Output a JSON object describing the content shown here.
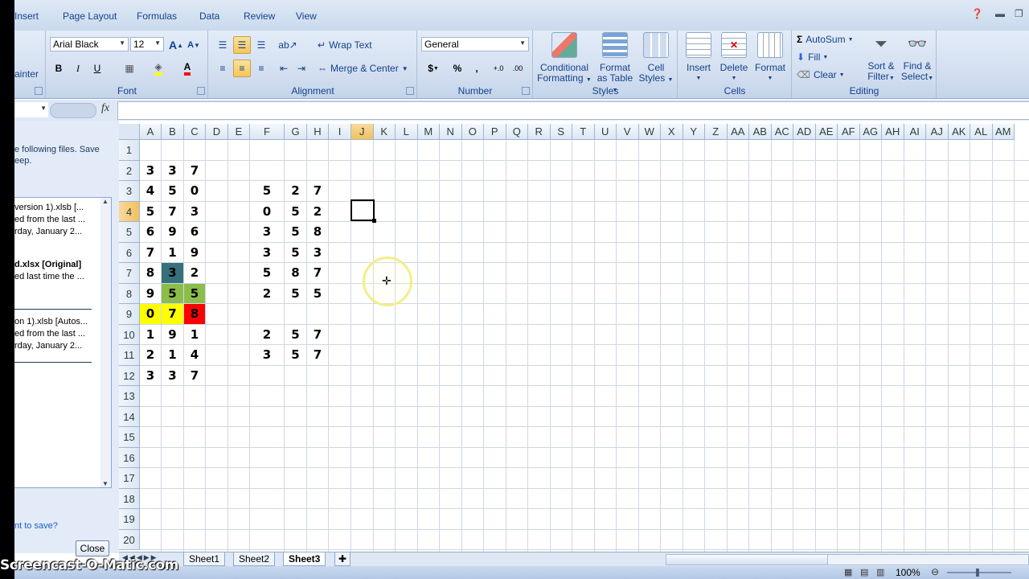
{
  "ribbon": {
    "tabs": [
      "Insert",
      "Page Layout",
      "Formulas",
      "Data",
      "Review",
      "View"
    ],
    "clipboard_partial": "ainter",
    "font": {
      "name": "Arial Black",
      "size": "12",
      "grow": "A",
      "shrink": "A",
      "bold": "B",
      "italic": "I",
      "underline": "U",
      "group_label": "Font"
    },
    "alignment": {
      "wrap_text": "Wrap Text",
      "merge_center": "Merge & Center",
      "group_label": "Alignment"
    },
    "number": {
      "format": "General",
      "currency": "$",
      "percent": "%",
      "comma": ",",
      "group_label": "Number"
    },
    "styles": {
      "conditional": [
        "Conditional",
        "Formatting"
      ],
      "format_table": [
        "Format",
        "as Table"
      ],
      "cell_styles": [
        "Cell",
        "Styles"
      ],
      "group_label": "Styles"
    },
    "cells": {
      "insert": "Insert",
      "delete": "Delete",
      "format": "Format",
      "group_label": "Cells"
    },
    "editing": {
      "autosum": "AutoSum",
      "fill": "Fill",
      "clear": "Clear",
      "sort": [
        "Sort &",
        "Filter"
      ],
      "find": [
        "Find &",
        "Select"
      ],
      "group_label": "Editing"
    }
  },
  "formula_bar": {
    "fx": "fx",
    "value": ""
  },
  "recovery_pane": {
    "intro": [
      "e following files.  Save",
      "eep."
    ],
    "files": [
      {
        "lines": [
          "version 1).xlsb  [...",
          "ed from the last ...",
          "rday, January 2..."
        ],
        "bold": false
      },
      {
        "lines": [
          "d.xlsx  [Original]",
          "ed last time the ..."
        ],
        "bold": true
      },
      {
        "lines": [
          "on 1).xlsb  [Autos...",
          "ed from the last ...",
          "rday, January 2..."
        ],
        "bold": false
      }
    ],
    "question": "nt to save?",
    "close": "Close"
  },
  "grid": {
    "columns": [
      "A",
      "B",
      "C",
      "D",
      "E",
      "F",
      "G",
      "H",
      "I",
      "J",
      "K",
      "L",
      "M",
      "N",
      "O",
      "P",
      "Q",
      "R",
      "S",
      "T",
      "U",
      "V",
      "W",
      "X",
      "Y",
      "Z",
      "AA",
      "AB",
      "AC",
      "AD",
      "AE",
      "AF",
      "AG",
      "AH",
      "AI",
      "AJ",
      "AK",
      "AL",
      "AM"
    ],
    "rows": [
      "1",
      "2",
      "3",
      "4",
      "5",
      "6",
      "7",
      "8",
      "9",
      "10",
      "11",
      "12",
      "13",
      "14",
      "15",
      "16",
      "17",
      "18",
      "19",
      "20"
    ],
    "active_column": "J",
    "active_row": "4",
    "cells": [
      {
        "c": "A",
        "r": 2,
        "v": "3"
      },
      {
        "c": "B",
        "r": 2,
        "v": "3"
      },
      {
        "c": "C",
        "r": 2,
        "v": "7"
      },
      {
        "c": "A",
        "r": 3,
        "v": "4"
      },
      {
        "c": "B",
        "r": 3,
        "v": "5"
      },
      {
        "c": "C",
        "r": 3,
        "v": "0"
      },
      {
        "c": "F",
        "r": 3,
        "v": "5"
      },
      {
        "c": "G",
        "r": 3,
        "v": "2"
      },
      {
        "c": "H",
        "r": 3,
        "v": "7"
      },
      {
        "c": "A",
        "r": 4,
        "v": "5"
      },
      {
        "c": "B",
        "r": 4,
        "v": "7"
      },
      {
        "c": "C",
        "r": 4,
        "v": "3"
      },
      {
        "c": "F",
        "r": 4,
        "v": "0"
      },
      {
        "c": "G",
        "r": 4,
        "v": "5"
      },
      {
        "c": "H",
        "r": 4,
        "v": "2"
      },
      {
        "c": "A",
        "r": 5,
        "v": "6"
      },
      {
        "c": "B",
        "r": 5,
        "v": "9"
      },
      {
        "c": "C",
        "r": 5,
        "v": "6"
      },
      {
        "c": "F",
        "r": 5,
        "v": "3"
      },
      {
        "c": "G",
        "r": 5,
        "v": "5"
      },
      {
        "c": "H",
        "r": 5,
        "v": "8"
      },
      {
        "c": "A",
        "r": 6,
        "v": "7"
      },
      {
        "c": "B",
        "r": 6,
        "v": "1"
      },
      {
        "c": "C",
        "r": 6,
        "v": "9"
      },
      {
        "c": "F",
        "r": 6,
        "v": "3"
      },
      {
        "c": "G",
        "r": 6,
        "v": "5"
      },
      {
        "c": "H",
        "r": 6,
        "v": "3"
      },
      {
        "c": "A",
        "r": 7,
        "v": "8"
      },
      {
        "c": "B",
        "r": 7,
        "v": "3",
        "bg": "#35707b"
      },
      {
        "c": "C",
        "r": 7,
        "v": "2"
      },
      {
        "c": "F",
        "r": 7,
        "v": "5"
      },
      {
        "c": "G",
        "r": 7,
        "v": "8"
      },
      {
        "c": "H",
        "r": 7,
        "v": "7"
      },
      {
        "c": "A",
        "r": 8,
        "v": "9"
      },
      {
        "c": "B",
        "r": 8,
        "v": "5",
        "bg": "#8cbd4a"
      },
      {
        "c": "C",
        "r": 8,
        "v": "5",
        "bg": "#8cbd4a"
      },
      {
        "c": "F",
        "r": 8,
        "v": "2"
      },
      {
        "c": "G",
        "r": 8,
        "v": "5"
      },
      {
        "c": "H",
        "r": 8,
        "v": "5"
      },
      {
        "c": "A",
        "r": 9,
        "v": "0",
        "bg": "#ffff00"
      },
      {
        "c": "B",
        "r": 9,
        "v": "7",
        "bg": "#ffff00"
      },
      {
        "c": "C",
        "r": 9,
        "v": "8",
        "bg": "#ff0000"
      },
      {
        "c": "A",
        "r": 10,
        "v": "1"
      },
      {
        "c": "B",
        "r": 10,
        "v": "9"
      },
      {
        "c": "C",
        "r": 10,
        "v": "1"
      },
      {
        "c": "F",
        "r": 10,
        "v": "2"
      },
      {
        "c": "G",
        "r": 10,
        "v": "5"
      },
      {
        "c": "H",
        "r": 10,
        "v": "7"
      },
      {
        "c": "A",
        "r": 11,
        "v": "2"
      },
      {
        "c": "B",
        "r": 11,
        "v": "1"
      },
      {
        "c": "C",
        "r": 11,
        "v": "4"
      },
      {
        "c": "F",
        "r": 11,
        "v": "3"
      },
      {
        "c": "G",
        "r": 11,
        "v": "5"
      },
      {
        "c": "H",
        "r": 11,
        "v": "7"
      },
      {
        "c": "A",
        "r": 12,
        "v": "3"
      },
      {
        "c": "B",
        "r": 12,
        "v": "3"
      },
      {
        "c": "C",
        "r": 12,
        "v": "7"
      }
    ]
  },
  "sheets": {
    "tabs": [
      "Sheet1",
      "Sheet2",
      "Sheet3"
    ],
    "active": "Sheet3"
  },
  "status": {
    "zoom": "100%"
  },
  "watermark": "Screencast-O-Matic.com"
}
